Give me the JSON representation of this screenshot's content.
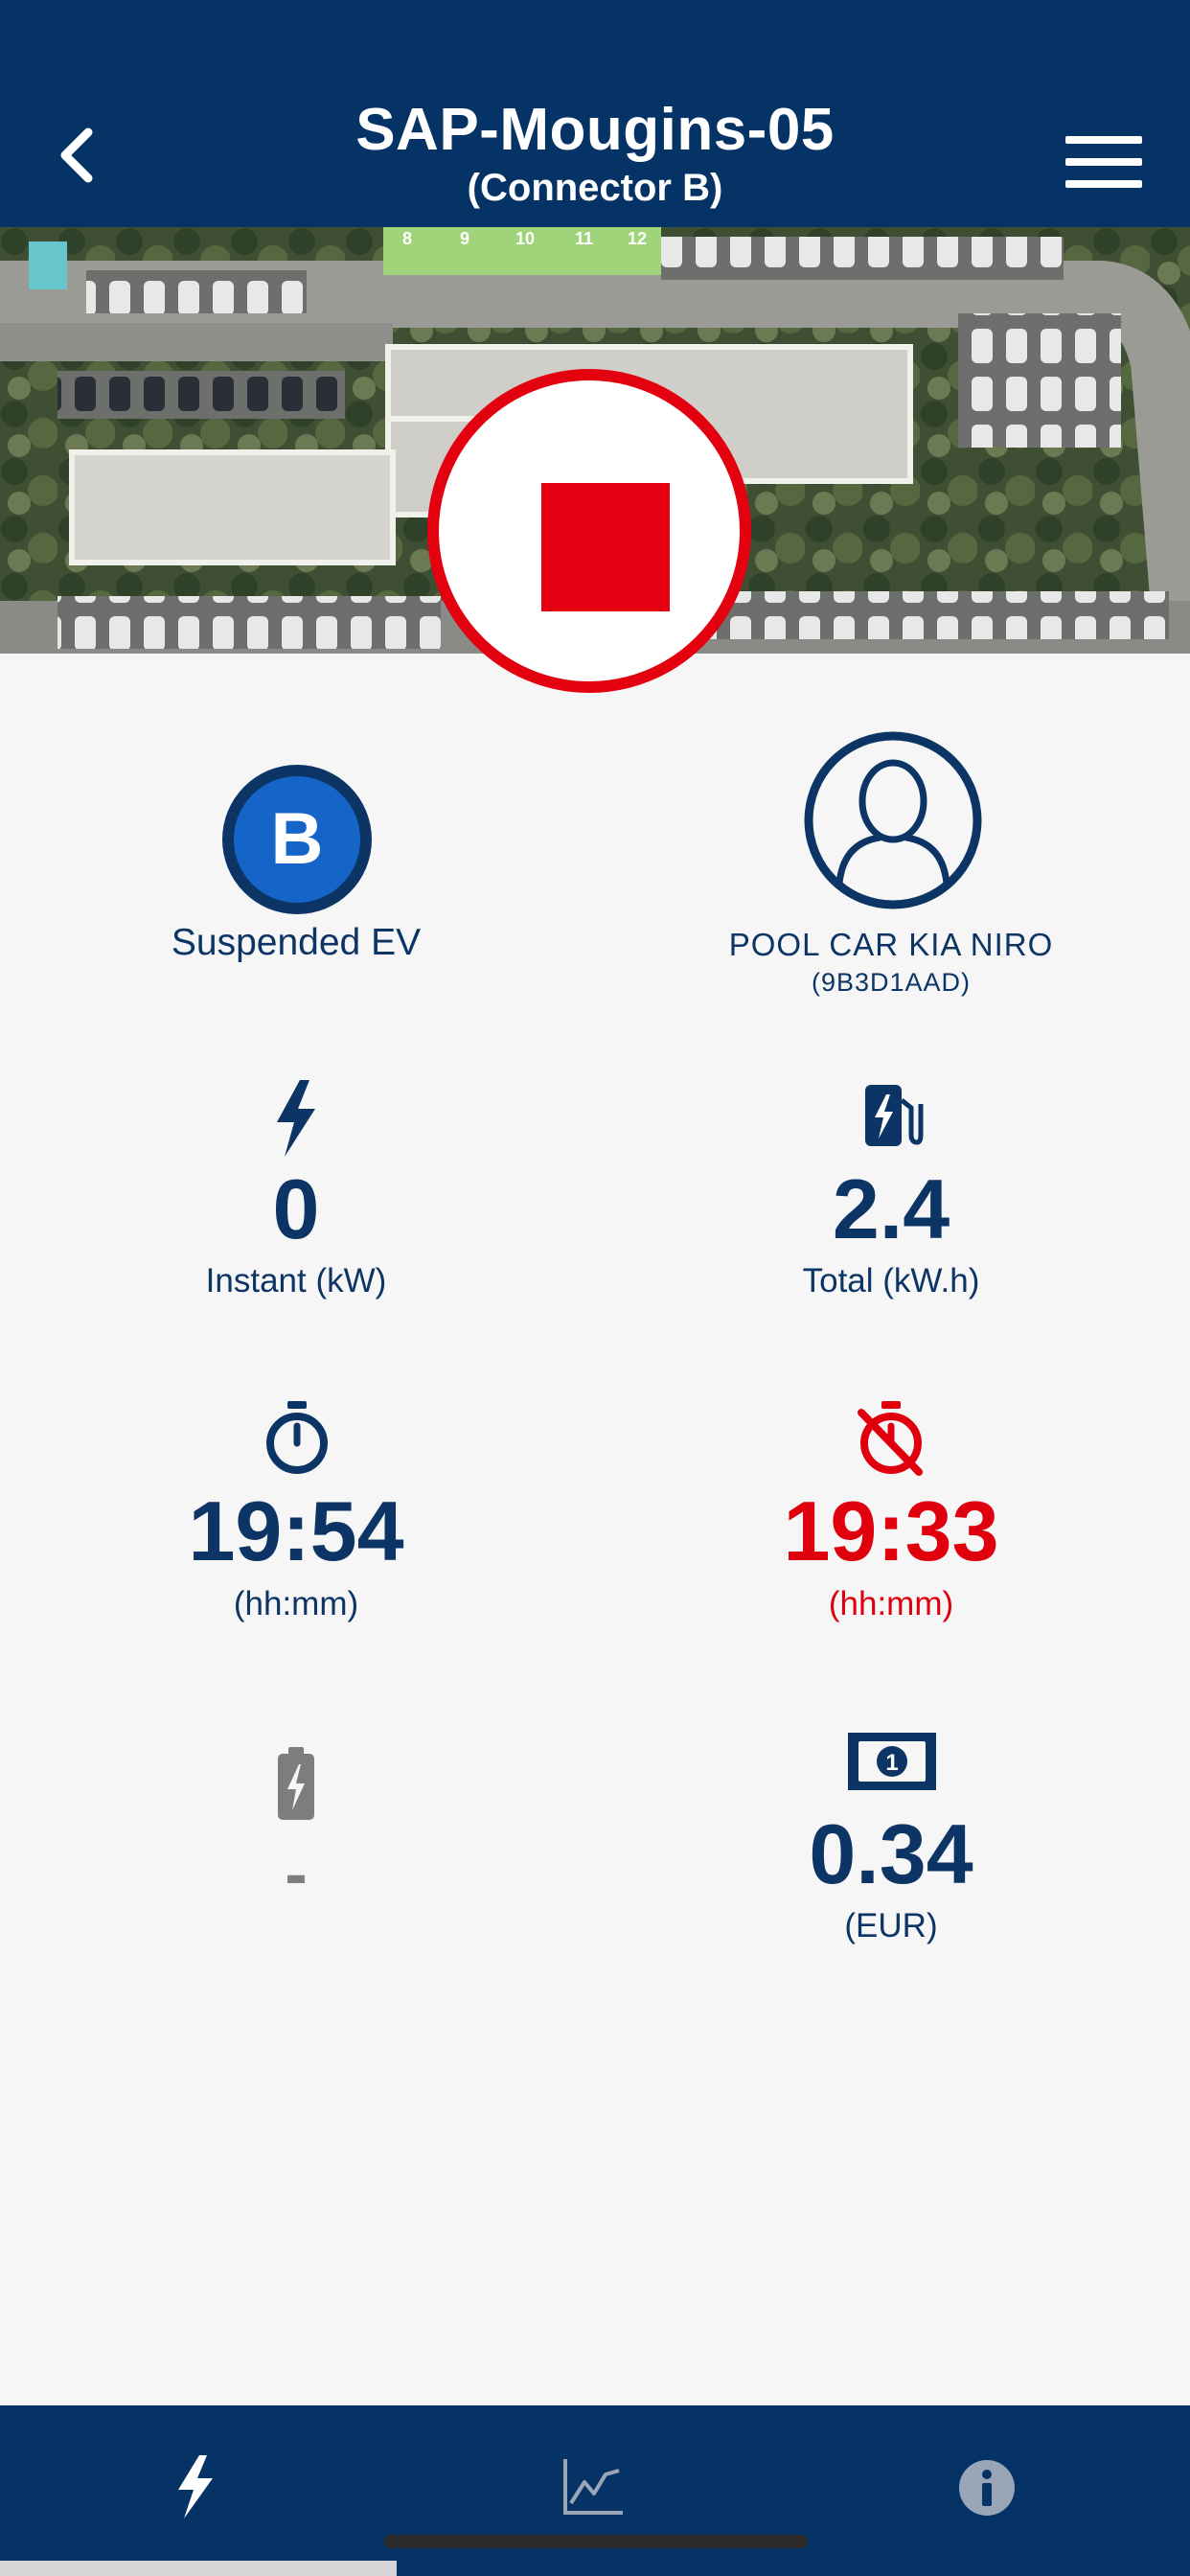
{
  "header": {
    "title": "SAP-Mougins-05",
    "subtitle": "(Connector B)"
  },
  "map": {
    "parking_numbers": [
      "8",
      "9",
      "10",
      "11",
      "12"
    ]
  },
  "connector": {
    "letter": "B",
    "status": "Suspended EV"
  },
  "user": {
    "name": "POOL CAR  KIA NIRO",
    "id": "(9B3D1AAD)"
  },
  "metrics": {
    "instant_value": "0",
    "instant_label": "Instant (kW)",
    "total_value": "2.4",
    "total_label": "Total (kW.h)",
    "elapsed_value": "19:54",
    "elapsed_label": "(hh:mm)",
    "inactivity_value": "19:33",
    "inactivity_label": "(hh:mm)",
    "battery_value": "-",
    "price_value": "0.34",
    "price_label": "(EUR)"
  },
  "colors": {
    "navy": "#063366",
    "text": "#0c3566",
    "stop_red": "#e3000f",
    "badge_blue": "#1565c8",
    "inactivity_red": "#e0000d"
  },
  "tabs": [
    {
      "icon": "lightning-icon",
      "active": true
    },
    {
      "icon": "chart-icon",
      "active": false
    },
    {
      "icon": "info-icon",
      "active": false
    }
  ]
}
